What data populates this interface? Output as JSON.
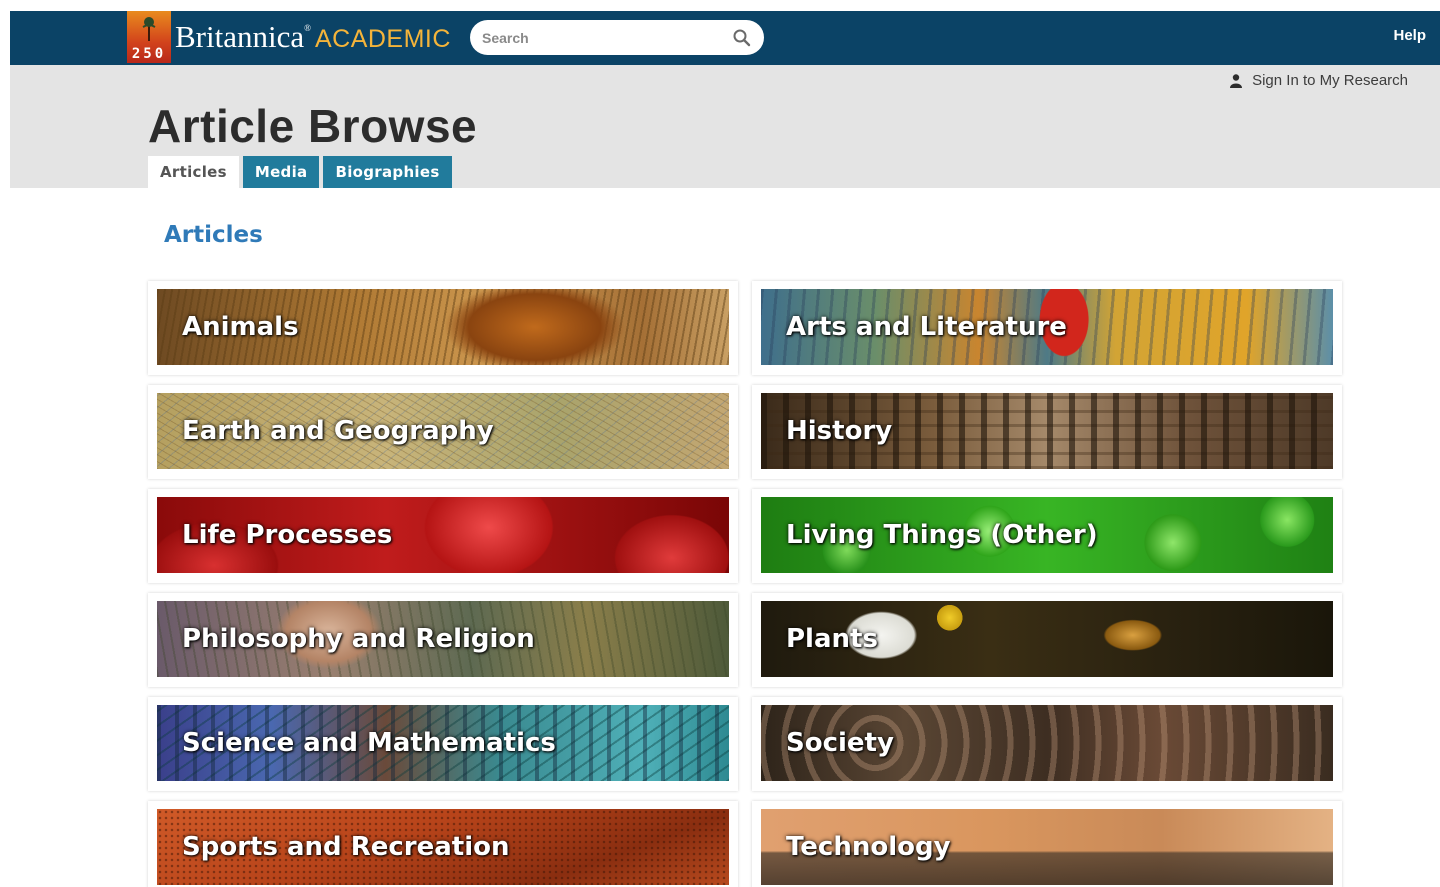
{
  "header": {
    "logo_badge_number": "250",
    "logo_brand": "Britannica",
    "logo_reg": "®",
    "logo_product": "ACADEMIC",
    "search_placeholder": "Search",
    "help_label": "Help"
  },
  "account": {
    "signin_label": "Sign In to My Research"
  },
  "page": {
    "title": "Article Browse",
    "tabs": [
      {
        "label": "Articles",
        "active": true
      },
      {
        "label": "Media",
        "active": false
      },
      {
        "label": "Biographies",
        "active": false
      }
    ],
    "section_heading": "Articles"
  },
  "categories": [
    {
      "label": "Animals"
    },
    {
      "label": "Arts and Literature"
    },
    {
      "label": "Earth and Geography"
    },
    {
      "label": "History"
    },
    {
      "label": "Life Processes"
    },
    {
      "label": "Living Things (Other)"
    },
    {
      "label": "Philosophy and Religion"
    },
    {
      "label": "Plants"
    },
    {
      "label": "Science and Mathematics"
    },
    {
      "label": "Society"
    },
    {
      "label": "Sports and Recreation"
    },
    {
      "label": "Technology"
    }
  ],
  "colors": {
    "topbar": "#0b4366",
    "header_band": "#e4e4e4",
    "tab_inactive": "#217b9c",
    "logo_product": "#f4b43a",
    "section_heading": "#2f7ab8"
  }
}
